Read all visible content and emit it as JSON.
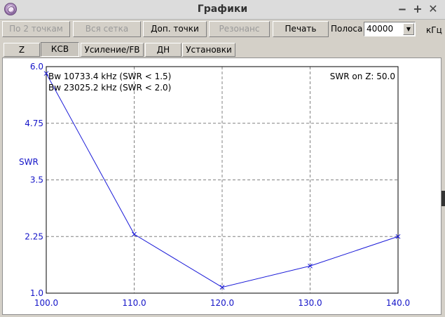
{
  "window": {
    "title": "Графики",
    "controls": [
      "‒",
      "+",
      "✕"
    ]
  },
  "toolbar": {
    "by_2_points": "По 2 точкам",
    "whole_grid": "Вся сетка",
    "extra_points": "Доп. точки",
    "resonance": "Резонанс",
    "print": "Печать",
    "band_label": "Полоса",
    "band_value": "40000",
    "band_unit": "кГц"
  },
  "tabs": [
    "Z",
    "КСВ",
    "Усиление/FB",
    "ДН",
    "Установки"
  ],
  "active_tab": "КСВ",
  "colors": {
    "line": "#1a1ad8",
    "axis_text": "#1414c8",
    "grid": "#808080"
  },
  "chart_data": {
    "type": "line",
    "ylabel": "SWR",
    "xlim": [
      100.0,
      140.0
    ],
    "ylim": [
      1.0,
      6.0
    ],
    "x_ticks": [
      "100.0",
      "110.0",
      "120.0",
      "130.0",
      "140.0"
    ],
    "y_ticks": [
      "1.0",
      "2.25",
      "3.5",
      "4.75",
      "6.0"
    ],
    "grid": true,
    "x": [
      100.0,
      110.0,
      120.0,
      130.0,
      140.0
    ],
    "series": [
      {
        "values": [
          5.85,
          2.3,
          1.13,
          1.6,
          2.25
        ]
      }
    ],
    "annotations": {
      "bw1": "Bw 10733.4 kHz (SWR < 1.5)",
      "bw2": "Bw 23025.2 kHz (SWR < 2.0)",
      "swr_on_z": "SWR on Z: 50.0"
    }
  }
}
